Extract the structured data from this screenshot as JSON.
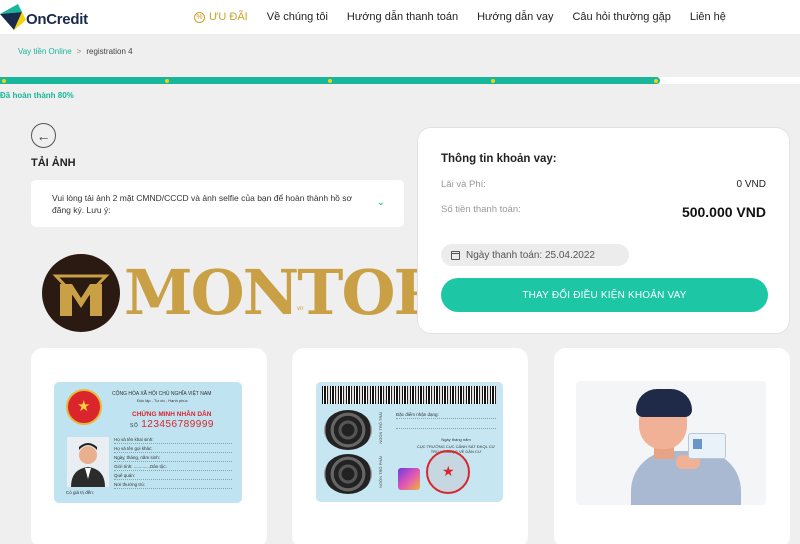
{
  "header": {
    "logo_text": "OnCredit",
    "nav": [
      {
        "label": "ƯU ĐÃI"
      },
      {
        "label": "Về chúng tôi"
      },
      {
        "label": "Hướng dẫn thanh toán"
      },
      {
        "label": "Hướng dẫn vay"
      },
      {
        "label": "Câu hỏi thường gặp"
      },
      {
        "label": "Liên hệ"
      }
    ]
  },
  "breadcrumb": {
    "parent": "Vay tiền Online",
    "separator": ">",
    "current": "registration 4"
  },
  "progress": {
    "label": "Đã hoàn thành 80%",
    "percent": 80,
    "steps": 5
  },
  "upload": {
    "title": "TẢI ẢNH",
    "notice": "Vui lòng tải ảnh 2 mặt CMND/CCCD và ảnh selfie của bạn để hoàn thành hồ sơ đăng ký. Lưu ý:"
  },
  "watermark": {
    "text": "MONTOP",
    "sub": "vn"
  },
  "loan": {
    "title": "Thông tin khoản vay:",
    "fee_label": "Lãi và Phí:",
    "fee_value": "0 VND",
    "payment_label": "Số tiền thanh toán:",
    "payment_value": "500.000 VND",
    "due_date": "Ngày thanh toán: 25.04.2022",
    "change_button": "THAY ĐỔI ĐIỀU KIỆN KHOẢN VAY"
  },
  "id_front": {
    "header1": "CỘNG HÒA XÃ HỘI CHỦ NGHĨA VIỆT NAM",
    "header2": "Độc lập - Tự do - Hạnh phúc",
    "title": "CHỨNG MINH NHÂN DÂN",
    "number_prefix": "SỐ",
    "number": "123456789999",
    "fields": [
      "Họ và tên khai sinh:",
      "Họ và tên gọi khác:",
      "Ngày, tháng, năm sinh:",
      "Giới tính: .............Dân tộc:",
      "Quê quán:",
      "Nơi thường trú:"
    ],
    "footer": "Có giá trị đến:"
  },
  "id_back": {
    "fields": [
      "Đặc điểm nhận dạng:"
    ],
    "sign_date": "Ngày  tháng  năm",
    "authority": "CỤC TRƯỞNG CỤC CẢNH SÁT ĐKQL CƯ TRÚ VÀ DLQG VỀ DÂN CƯ",
    "left_finger": "NGÓN TRỎ TRÁI",
    "right_finger": "NGÓN TRỎ PHẢI"
  },
  "colors": {
    "brand": "#18b69b",
    "button": "#1dc7a6",
    "promo": "#c9a227",
    "progress_dot": "#f5d10a"
  }
}
